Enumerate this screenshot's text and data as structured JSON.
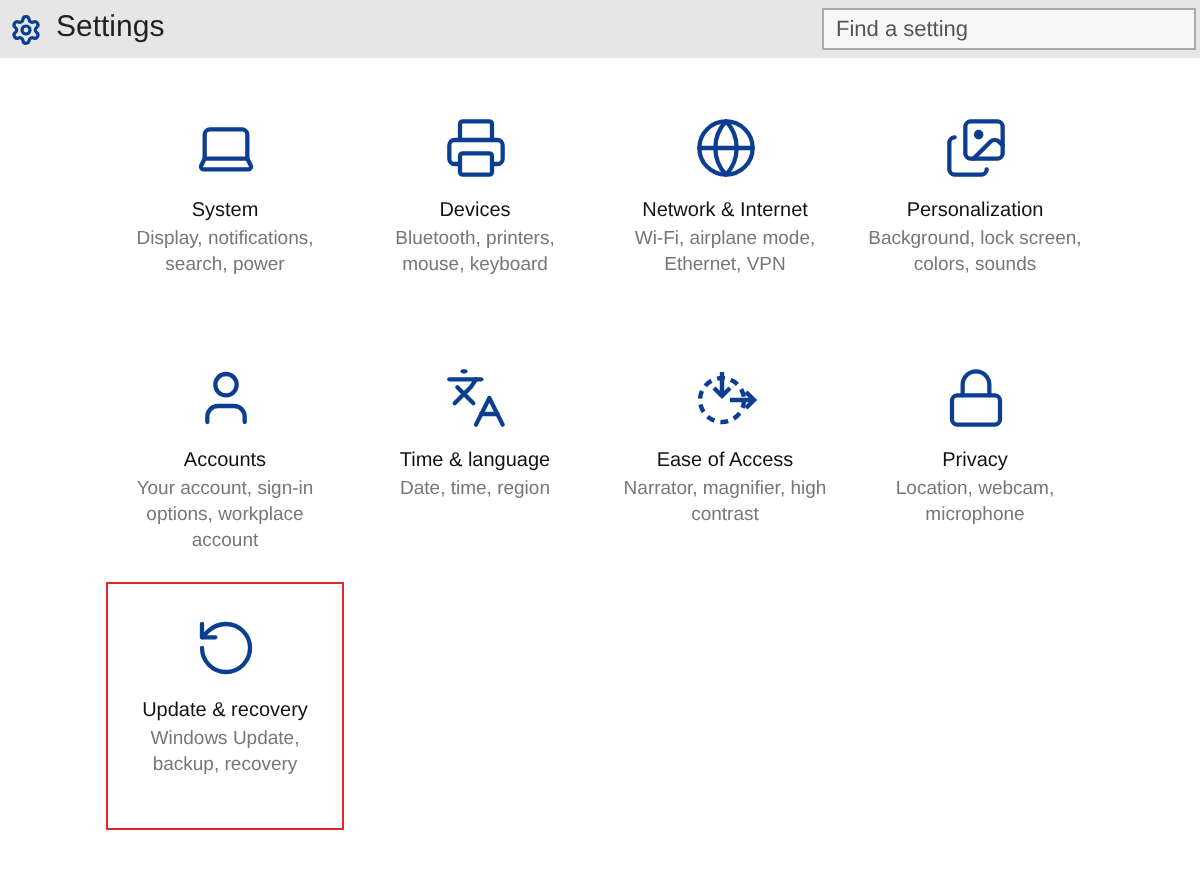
{
  "window": {
    "title": "Settings"
  },
  "search": {
    "placeholder": "Find a setting"
  },
  "items": [
    {
      "kind": "system",
      "title": "System",
      "description": "Display, notifications, search, power",
      "highlighted": false
    },
    {
      "kind": "devices",
      "title": "Devices",
      "description": "Bluetooth, printers, mouse, keyboard",
      "highlighted": false
    },
    {
      "kind": "network",
      "title": "Network & Internet",
      "description": "Wi-Fi, airplane mode, Ethernet, VPN",
      "highlighted": false
    },
    {
      "kind": "personalization",
      "title": "Personalization",
      "description": "Background, lock screen, colors, sounds",
      "highlighted": false
    },
    {
      "kind": "accounts",
      "title": "Accounts",
      "description": "Your account, sign-in options, workplace account",
      "highlighted": false
    },
    {
      "kind": "time",
      "title": "Time & language",
      "description": "Date, time, region",
      "highlighted": false
    },
    {
      "kind": "ease",
      "title": "Ease of Access",
      "description": "Narrator, magnifier, high contrast",
      "highlighted": false
    },
    {
      "kind": "privacy",
      "title": "Privacy",
      "description": "Location, webcam, microphone",
      "highlighted": false
    },
    {
      "kind": "update",
      "title": "Update & recovery",
      "description": "Windows Update, backup, recovery",
      "highlighted": true
    }
  ]
}
